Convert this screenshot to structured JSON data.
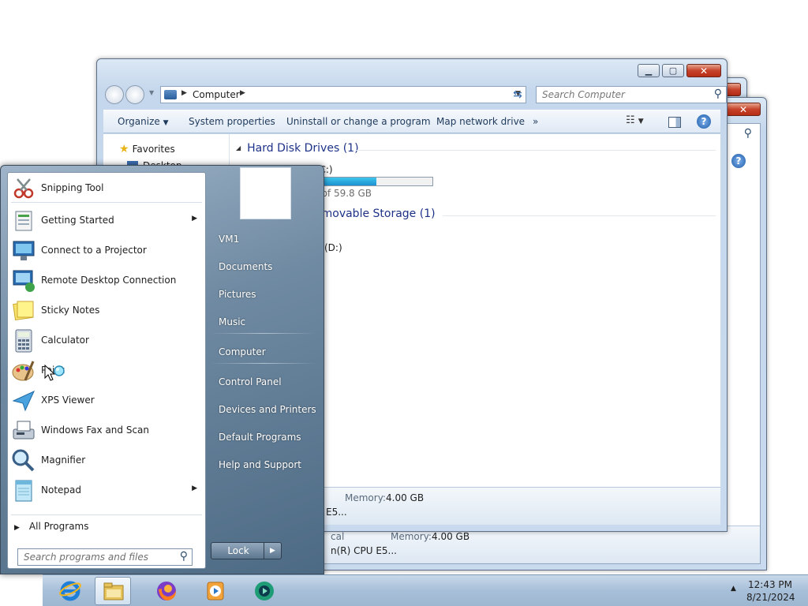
{
  "explorer": {
    "address": {
      "crumb": "Computer"
    },
    "search_placeholder": "Search Computer",
    "toolbar": {
      "organize": "Organize",
      "system_properties": "System properties",
      "uninstall": "Uninstall or change a program",
      "map_drive": "Map network drive",
      "more": "»"
    },
    "nav": {
      "favorites": "Favorites",
      "desktop": "Desktop"
    },
    "groups": {
      "hdd": "Hard Disk Drives (1)",
      "removable": "emovable Storage (1)"
    },
    "drive_c": {
      "name": "k (C:)",
      "free": "ee of 59.8 GB",
      "used_fraction": 0.55
    },
    "drive_d": {
      "name": "(D:)"
    },
    "details": {
      "memory_label": "Memory:",
      "memory_value": "4.00 GB",
      "cpu_partial": "E5..."
    }
  },
  "back_window": {
    "memory_label": "Memory:",
    "memory_value": "4.00 GB",
    "type_partial": "cal",
    "cpu_partial": "n(R) CPU E5..."
  },
  "start_menu": {
    "programs": [
      {
        "label": "Snipping Tool",
        "icon": "scissors-icon",
        "submenu": false
      },
      {
        "label": "Getting Started",
        "icon": "getting-started-icon",
        "submenu": true
      },
      {
        "label": "Connect to a Projector",
        "icon": "projector-icon",
        "submenu": false
      },
      {
        "label": "Remote Desktop Connection",
        "icon": "remote-desktop-icon",
        "submenu": false
      },
      {
        "label": "Sticky Notes",
        "icon": "sticky-notes-icon",
        "submenu": false
      },
      {
        "label": "Calculator",
        "icon": "calculator-icon",
        "submenu": false
      },
      {
        "label": "Paint",
        "icon": "paint-icon",
        "submenu": false
      },
      {
        "label": "XPS Viewer",
        "icon": "xps-viewer-icon",
        "submenu": false
      },
      {
        "label": "Windows Fax and Scan",
        "icon": "fax-icon",
        "submenu": false
      },
      {
        "label": "Magnifier",
        "icon": "magnifier-icon",
        "submenu": false
      },
      {
        "label": "Notepad",
        "icon": "notepad-icon",
        "submenu": true
      }
    ],
    "all_programs": "All Programs",
    "search_placeholder": "Search programs and files",
    "right_links": [
      "VM1",
      "Documents",
      "Pictures",
      "Music",
      "Computer",
      "Control Panel",
      "Devices and Printers",
      "Default Programs",
      "Help and Support"
    ],
    "lock_label": "Lock"
  },
  "taskbar": {
    "apps": [
      "internet-explorer-icon",
      "file-explorer-icon",
      "firefox-icon",
      "media-player-icon",
      "vscode-like-icon"
    ],
    "clock_time": "12:43 PM",
    "clock_date": "8/21/2024"
  },
  "colors": {
    "start_gradient_top": "#9fb4c8",
    "start_gradient_bottom": "#4d6a84",
    "close_button": "#c7432b",
    "drive_fill": "#1b91cf",
    "group_header": "#1e3287"
  }
}
